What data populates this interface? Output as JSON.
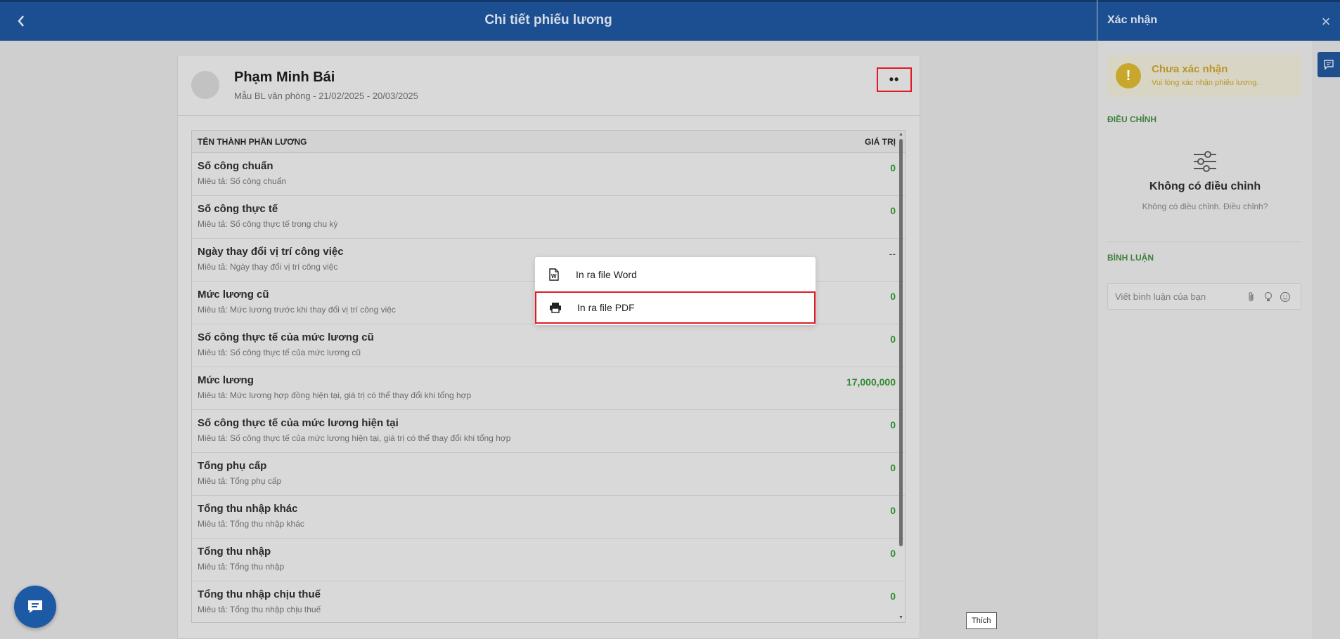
{
  "header": {
    "title": "Chi tiết phiếu lương"
  },
  "employee": {
    "name": "Phạm Minh Bái",
    "subtitle": "Mẫu BL văn phòng - 21/02/2025 - 20/03/2025",
    "more_label": "••"
  },
  "table": {
    "col_name": "TÊN THÀNH PHẦN LƯƠNG",
    "col_value": "GIÁ TRỊ",
    "rows": [
      {
        "name": "Số công chuẩn",
        "desc": "Miêu tả: Số công chuẩn",
        "value": "0"
      },
      {
        "name": "Số công thực tế",
        "desc": "Miêu tả: Số công thực tế trong chu kỳ",
        "value": "0"
      },
      {
        "name": "Ngày thay đổi vị trí công việc",
        "desc": "Miêu tả: Ngày thay đổi vị trí công việc",
        "value": "--"
      },
      {
        "name": "Mức lương cũ",
        "desc": "Miêu tả: Mức lương trước khi thay đổi vị trí công việc",
        "value": "0"
      },
      {
        "name": "Số công thực tế của mức lương cũ",
        "desc": "Miêu tả: Số công thực tế của mức lương cũ",
        "value": "0"
      },
      {
        "name": "Mức lương",
        "desc": "Miêu tả: Mức lương hợp đồng hiện tại, giá trị có thể thay đổi khi tổng hợp",
        "value": "17,000,000"
      },
      {
        "name": "Số công thực tế của mức lương hiện tại",
        "desc": "Miêu tả: Số công thực tế của mức lương hiện tại, giá trị có thể thay đổi khi tổng hợp",
        "value": "0"
      },
      {
        "name": "Tổng phụ cấp",
        "desc": "Miêu tả: Tổng phụ cấp",
        "value": "0"
      },
      {
        "name": "Tổng thu nhập khác",
        "desc": "Miêu tả: Tổng thu nhập khác",
        "value": "0"
      },
      {
        "name": "Tổng thu nhập",
        "desc": "Miêu tả: Tổng thu nhập",
        "value": "0"
      },
      {
        "name": "Tổng thu nhập chịu thuế",
        "desc": "Miêu tả: Tổng thu nhập chịu thuế",
        "value": "0"
      }
    ]
  },
  "menu": {
    "word_label": "In ra file Word",
    "pdf_label": "In ra file PDF"
  },
  "right_panel": {
    "title": "Xác nhận",
    "status_title": "Chưa xác nhận",
    "status_sub": "Vui lòng xác nhận phiếu lương.",
    "status_icon": "!",
    "adjust_section": "ĐIỀU CHỈNH",
    "adjust_title": "Không có điều chỉnh",
    "adjust_sub": "Không có điều chỉnh. Điều chỉnh?",
    "comment_section": "BÌNH LUẬN",
    "comment_placeholder": "Viết bình luận của bạn"
  },
  "tooltip": "Thích",
  "close_label": "×",
  "colors": {
    "header": "#1c4f91",
    "accent_green": "#2f8b2f",
    "highlight_red": "#e01b24",
    "warning": "#c7a72c"
  }
}
